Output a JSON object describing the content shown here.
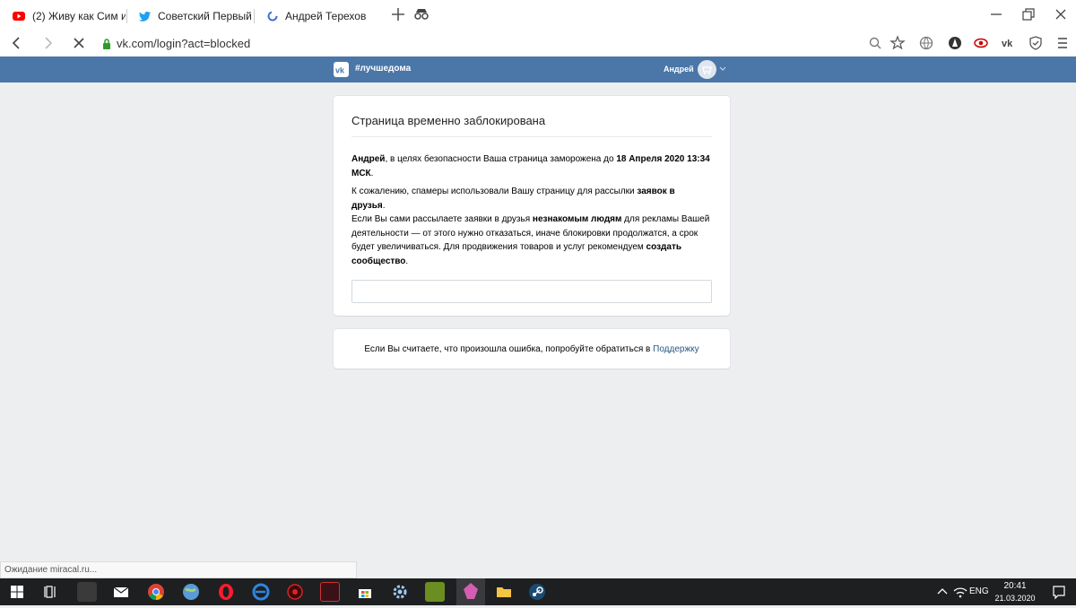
{
  "browser": {
    "tabs": [
      {
        "title": "(2) Живу как Сим из TI",
        "icon": "youtube-icon"
      },
      {
        "title": "Советский Первый ка",
        "icon": "twitter-icon"
      },
      {
        "title": "Андрей Терехов",
        "icon": "loading-icon"
      }
    ],
    "url": "vk.com/login?act=blocked",
    "status": "Ожидание miracal.ru..."
  },
  "vk_header": {
    "hashtag": "#лучшедома",
    "user_name": "Андрей"
  },
  "blocked_card": {
    "title": "Страница временно заблокирована",
    "p1_name": "Андрей",
    "p1_text": ", в целях безопасности Ваша страница заморожена до ",
    "p1_date": "18 Апреля 2020 13:34 МСК",
    "p1_end": ".",
    "p2_text": "К сожалению, спамеры использовали Вашу страницу для рассылки ",
    "p2_bold": "заявок в друзья",
    "p2_end": ".",
    "p3_text1": "Если Вы сами рассылаете заявки в друзья ",
    "p3_bold1": "незнакомым людям",
    "p3_text2": " для рекламы Вашей деятельности — от этого нужно отказаться, иначе блокировки продолжатся, а срок будет увеличиваться. Для продвижения товаров и услуг рекомендуем ",
    "p3_bold2": "создать сообщество",
    "p3_end": "."
  },
  "support_card": {
    "text": "Если Вы считаете, что произошла ошибка, попробуйте обратиться в ",
    "link": "Поддержку"
  },
  "taskbar": {
    "language": "ENG",
    "time": "20:41",
    "date": "21.03.2020"
  },
  "colors": {
    "vk_blue": "#4a76a8",
    "link": "#2a5885",
    "page_bg": "#edeef0"
  }
}
